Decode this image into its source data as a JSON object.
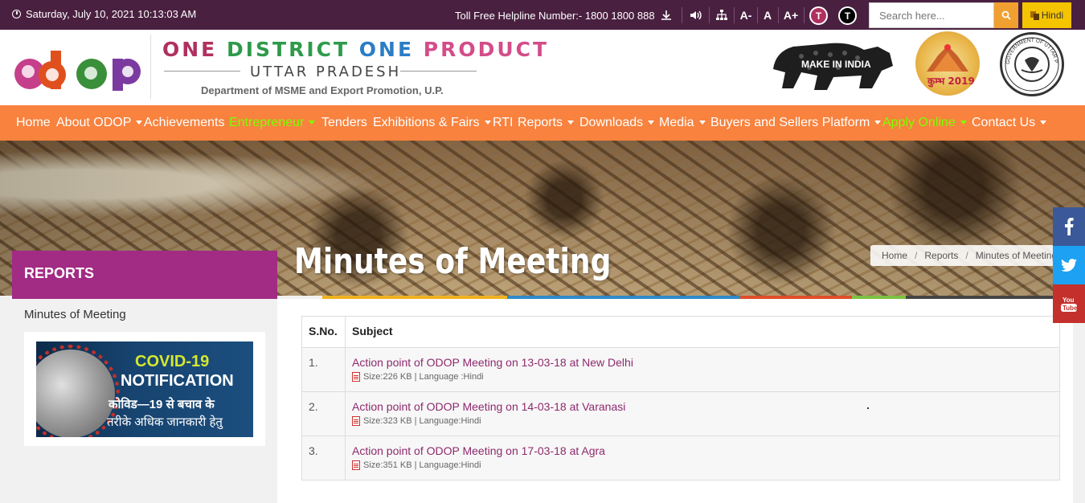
{
  "topbar": {
    "datetime": "Saturday, July 10, 2021 10:13:03 AM",
    "helpline": "Toll Free Helpline Number:- 1800 1800 888",
    "font_decrease": "A-",
    "font_normal": "A",
    "font_increase": "A+",
    "theme1": "T",
    "theme2": "T",
    "search_placeholder": "Search here...",
    "language_label": "Hindi"
  },
  "header": {
    "title_words": [
      "ONE",
      "DISTRICT",
      "ONE",
      "PRODUCT"
    ],
    "subtitle": "UTTAR PRADESH",
    "department": "Department of MSME and Export Promotion, U.P.",
    "logo_letters": [
      "o",
      "d",
      "o",
      "p"
    ],
    "make_in_india": "MAKE IN INDIA",
    "kumbh_text": "कुम्भ 2019",
    "seal_text": "GOVERNMENT OF UTTAR PRADESH"
  },
  "nav": [
    {
      "label": "Home",
      "dropdown": false,
      "highlight": false
    },
    {
      "label": "About ODOP",
      "dropdown": true,
      "highlight": false
    },
    {
      "label": "Achievements",
      "dropdown": false,
      "highlight": false
    },
    {
      "label": "Entrepreneur",
      "dropdown": true,
      "highlight": true
    },
    {
      "label": "Tenders",
      "dropdown": false,
      "highlight": false
    },
    {
      "label": "Exhibitions & Fairs",
      "dropdown": true,
      "highlight": false
    },
    {
      "label": "RTI",
      "dropdown": false,
      "highlight": false
    },
    {
      "label": "Reports",
      "dropdown": true,
      "highlight": false
    },
    {
      "label": "Downloads",
      "dropdown": true,
      "highlight": false
    },
    {
      "label": "Media",
      "dropdown": true,
      "highlight": false
    },
    {
      "label": "Buyers and Sellers Platform",
      "dropdown": true,
      "highlight": false
    },
    {
      "label": "Apply Online",
      "dropdown": true,
      "highlight": true
    },
    {
      "label": "Contact Us",
      "dropdown": true,
      "highlight": false
    }
  ],
  "banner": {
    "heading": "Minutes of Meeting",
    "breadcrumb": [
      "Home",
      "Reports",
      "Minutes of Meeting"
    ]
  },
  "sidebar": {
    "heading": "REPORTS",
    "link": "Minutes of Meeting",
    "covid": {
      "line1": "COVID-19",
      "line2": "NOTIFICATION",
      "line3": "कोविड—19 से बचाव के",
      "line4": "तरीके अधिक जानकारी हेतु"
    }
  },
  "table": {
    "headers": [
      "S.No.",
      "Subject"
    ],
    "rows": [
      {
        "sno": "1.",
        "subject": "Action point of ODOP Meeting on 13-03-18 at New Delhi",
        "meta": "Size:226 KB | Language :Hindi"
      },
      {
        "sno": "2.",
        "subject": "Action point of ODOP Meeting on 14-03-18 at Varanasi",
        "meta": "Size:323 KB | Language:Hindi"
      },
      {
        "sno": "3.",
        "subject": "Action point of ODOP Meeting on 17-03-18 at Agra",
        "meta": "Size:351 KB | Language:Hindi"
      }
    ]
  },
  "social": [
    {
      "name": "facebook",
      "glyph": "f",
      "color": "#3b5998"
    },
    {
      "name": "twitter",
      "glyph": "t",
      "color": "#1da1f2"
    },
    {
      "name": "youtube",
      "glyph": "You Tube",
      "color": "#c4302b"
    }
  ],
  "colors": {
    "topbar": "#4a2040",
    "nav": "#f8823e",
    "nav_highlight": "#7dff00",
    "reports_header": "#a22b84",
    "link": "#8e2a6e"
  }
}
